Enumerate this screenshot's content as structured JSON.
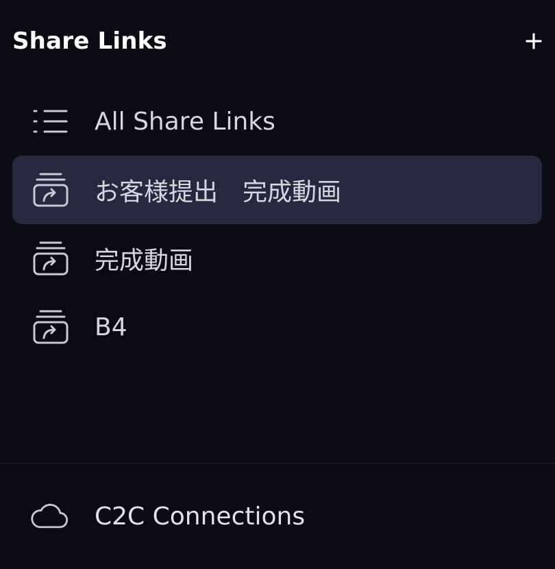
{
  "header": {
    "title": "Share Links",
    "add_icon": "plus-icon"
  },
  "list": {
    "items": [
      {
        "label": "All Share Links",
        "icon": "list-icon",
        "selected": false
      },
      {
        "label": "お客様提出　完成動画",
        "icon": "share-link-icon",
        "selected": true
      },
      {
        "label": "完成動画",
        "icon": "share-link-icon",
        "selected": false
      },
      {
        "label": "B4",
        "icon": "share-link-icon",
        "selected": false
      }
    ]
  },
  "footer": {
    "label": "C2C Connections",
    "icon": "cloud-icon"
  },
  "colors": {
    "background": "#0b0b14",
    "selected_background": "#262840",
    "text": "#d6d6df"
  }
}
